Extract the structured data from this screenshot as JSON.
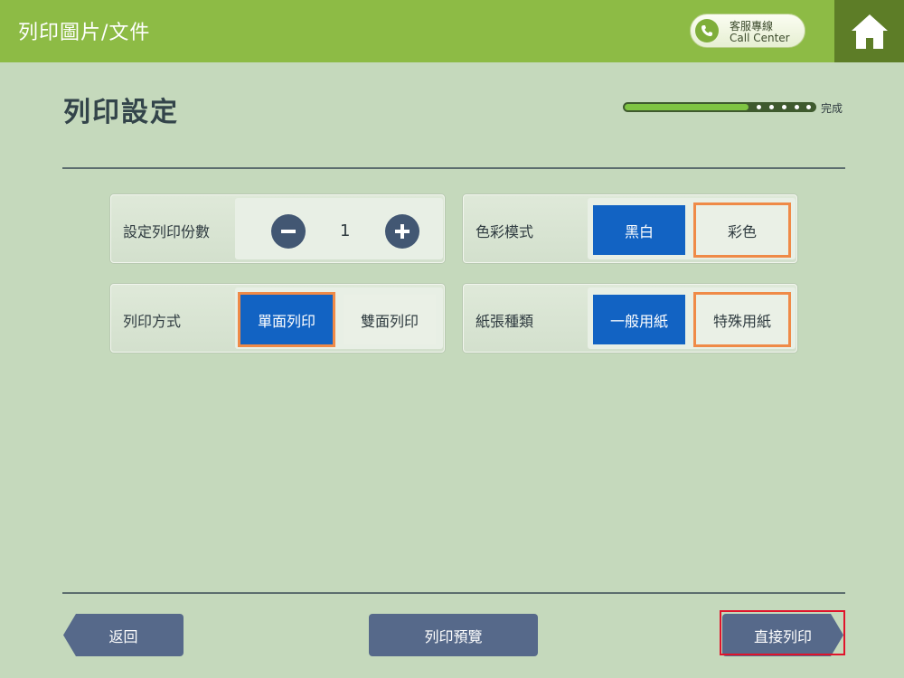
{
  "header": {
    "title": "列印圖片/文件",
    "call_center_line1": "客服專線",
    "call_center_line2": "Call Center",
    "call_icon": "phone-icon",
    "home_icon": "home-icon",
    "accent_color": "#8dbb45"
  },
  "page": {
    "title": "列印設定",
    "progress_label": "完成",
    "progress_fraction": 0.65
  },
  "settings": {
    "copies": {
      "label": "設定列印份數",
      "value": "1",
      "minus_icon": "minus-icon",
      "plus_icon": "plus-icon"
    },
    "color": {
      "label": "色彩模式",
      "options": [
        "黑白",
        "彩色"
      ],
      "selected": "黑白"
    },
    "duplex": {
      "label": "列印方式",
      "options": [
        "單面列印",
        "雙面列印"
      ],
      "selected": "單面列印"
    },
    "paper": {
      "label": "紙張種類",
      "options": [
        "一般用紙",
        "特殊用紙"
      ],
      "selected": "一般用紙"
    },
    "selected_color": "#1263c3"
  },
  "footer": {
    "back_label": "返回",
    "preview_label": "列印預覽",
    "print_label": "直接列印"
  }
}
